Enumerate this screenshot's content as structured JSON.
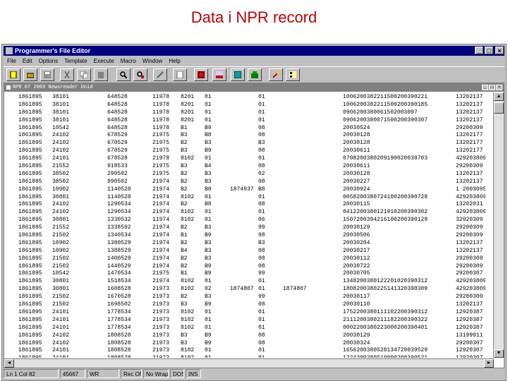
{
  "slide_title": "Data i NPR record",
  "window": {
    "title": "Programmer's File Editor"
  },
  "menu": [
    "File",
    "Edit",
    "Options",
    "Template",
    "Execute",
    "Macro",
    "Window",
    "Help"
  ],
  "toolbar_icons": [
    "new-file-icon",
    "open-folder-icon",
    "save-icon",
    "cut-icon",
    "copy-icon",
    "paste-icon",
    "find-icon",
    "find-next-icon",
    "replace-icon",
    "print-icon",
    "record-icon",
    "msdos-icon",
    "window-icon",
    "help-icon",
    "wrench-icon",
    "line-number-icon"
  ],
  "child_window": {
    "title": "NPR 07 2003 Newsreader Unid"
  },
  "rows": [
    [
      "1861895",
      "38101",
      "648528",
      "11978",
      "8201",
      "01",
      "",
      "01",
      "",
      "1006200382211500200390221",
      "13202137"
    ],
    [
      "1861895",
      "38101",
      "648528",
      "11978",
      "8201",
      "01",
      "",
      "01",
      "",
      "1006200382211500200390185",
      "13202137"
    ],
    [
      "1861895",
      "38101",
      "648528",
      "11978",
      "8201",
      "01",
      "",
      "01",
      "",
      "0906200380061502003097",
      "13202137"
    ],
    [
      "1861895",
      "38101",
      "648528",
      "11978",
      "8201",
      "01",
      "",
      "01",
      "",
      "0906200380071500200390307",
      "13202137"
    ],
    [
      "1861895",
      "10542",
      "648528",
      "11978",
      "B1",
      "B9",
      "",
      "08",
      "",
      "20030524",
      "29200309"
    ],
    [
      "1861895",
      "24102",
      "678529",
      "21975",
      "B3",
      "B8",
      "",
      "08",
      "",
      "20030128",
      "13202177"
    ],
    [
      "1861895",
      "24102",
      "678529",
      "21975",
      "B2",
      "B3",
      "",
      "B3",
      "",
      "20030128",
      "13202177"
    ],
    [
      "1861895",
      "24102",
      "678529",
      "21975",
      "B3",
      "B9",
      "",
      "08",
      "",
      "20030611",
      "13202177"
    ],
    [
      "1861895",
      "24101",
      "678528",
      "21978",
      "8102",
      "01",
      "",
      "01",
      "",
      "0708200380209190020038703",
      "4292038096"
    ],
    [
      "1861895",
      "21552",
      "918533",
      "21975",
      "B3",
      "B4",
      "",
      "08",
      "",
      "20030611",
      "29200309"
    ],
    [
      "1861895",
      "38502",
      "290502",
      "21975",
      "B2",
      "B3",
      "",
      "02",
      "",
      "20030128",
      "13202137"
    ],
    [
      "1861895",
      "38502",
      "990502",
      "21974",
      "B2",
      "B3",
      "",
      "08",
      "",
      "20030227",
      "13202137"
    ],
    [
      "1861895",
      "10902",
      "1140528",
      "21974",
      "B2",
      "B0",
      "1874937",
      "B8",
      "",
      "20030924",
      "1 2003095"
    ],
    [
      "1861895",
      "30801",
      "1140528",
      "21974",
      "8102",
      "01",
      "",
      "01",
      "",
      "0058200380724100200390728",
      "4292038099"
    ],
    [
      "1861895",
      "24102",
      "1290534",
      "21974",
      "B2",
      "B8",
      "",
      "08",
      "",
      "20030115",
      "13202031"
    ],
    [
      "1861895",
      "24102",
      "1290534",
      "21974",
      "8102",
      "01",
      "",
      "01",
      "",
      "0412200380121910200390302",
      "4292038098"
    ],
    [
      "1861895",
      "30801",
      "1330532",
      "11974",
      "8102",
      "01",
      "",
      "06",
      "",
      "1507200394216100200390129",
      "32920309"
    ],
    [
      "1861895",
      "21552",
      "1338592",
      "21974",
      "B2",
      "B3",
      "",
      "99",
      "",
      "20030129",
      "29200309"
    ],
    [
      "1861895",
      "21502",
      "1340534",
      "21974",
      "B1",
      "B9",
      "",
      "08",
      "",
      "20030506",
      "29200309"
    ],
    [
      "1861895",
      "10902",
      "1380529",
      "21974",
      "B2",
      "B3",
      "",
      "B3",
      "",
      "20030204",
      "13202137"
    ],
    [
      "1861895",
      "10902",
      "1388529",
      "21974",
      "B4",
      "B3",
      "",
      "08",
      "",
      "20030217",
      "13202137"
    ],
    [
      "1861895",
      "21502",
      "1400529",
      "21974",
      "B2",
      "B3",
      "",
      "08",
      "",
      "20030112",
      "29200309"
    ],
    [
      "1861895",
      "21502",
      "1440529",
      "21974",
      "B2",
      "B9",
      "",
      "08",
      "",
      "20030722",
      "29200309"
    ],
    [
      "1861895",
      "10542",
      "1470534",
      "21975",
      "B1",
      "B9",
      "",
      "99",
      "",
      "20030705",
      "29200307"
    ],
    [
      "1861895",
      "30801",
      "1518534",
      "21974",
      "8102",
      "01",
      "",
      "01",
      "",
      "1348200380122201020390312",
      "4292038099"
    ],
    [
      "1861895",
      "30801",
      "1608528",
      "21973",
      "8102",
      "02",
      "1874807",
      "01",
      "1874807",
      "1808200380225141320390309",
      "4292038099"
    ],
    [
      "1861895",
      "21502",
      "1670528",
      "21973",
      "B2",
      "B3",
      "",
      "99",
      "",
      "20030117",
      "29200309"
    ],
    [
      "1861895",
      "21502",
      "1698502",
      "21973",
      "B3",
      "B9",
      "",
      "08",
      "",
      "20030110",
      "13202137"
    ],
    [
      "1861895",
      "24101",
      "1778534",
      "21973",
      "8102",
      "01",
      "",
      "01",
      "",
      "1752200380111102200390312",
      "12920387"
    ],
    [
      "1861895",
      "24101",
      "1778534",
      "21973",
      "8102",
      "01",
      "",
      "01",
      "",
      "2111200380211182200390322",
      "12920387"
    ],
    [
      "1861895",
      "24101",
      "1778534",
      "21973",
      "8102",
      "01",
      "",
      "01",
      "",
      "0002200380223000200390401",
      "12920387"
    ],
    [
      "1861895",
      "24102",
      "1808528",
      "21973",
      "B3",
      "B9",
      "",
      "08",
      "",
      "20030129",
      "13199911"
    ],
    [
      "1861895",
      "24102",
      "1808528",
      "21973",
      "B3",
      "B9",
      "",
      "08",
      "",
      "20030324",
      "29200307"
    ],
    [
      "1861895",
      "24101",
      "1808528",
      "21973",
      "8102",
      "01",
      "",
      "01",
      "",
      "1656200380528134720039529",
      "12920307"
    ],
    [
      "1861895",
      "24101",
      "1808528",
      "21973",
      "8102",
      "01",
      "",
      "01",
      "",
      "1224200380510000200390521",
      "12920307"
    ]
  ],
  "status": {
    "position": "Ln 1 Col 82",
    "code": "45667",
    "wrap": "WR",
    "mode": "Rec Off",
    "flags": "No Wrap",
    "encoding": "DOS",
    "ins": "INS"
  }
}
